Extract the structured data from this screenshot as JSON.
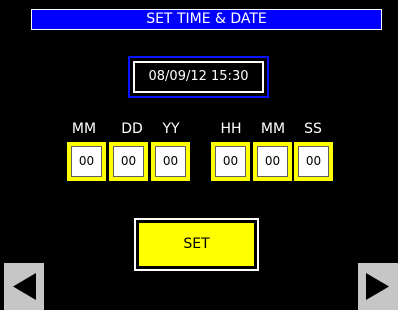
{
  "screen": {
    "title": "SET TIME & DATE",
    "current_datetime": "08/09/12  15:30",
    "fields": [
      {
        "label": "MM",
        "value": "00"
      },
      {
        "label": "DD",
        "value": "00"
      },
      {
        "label": "YY",
        "value": "00"
      },
      {
        "label": "HH",
        "value": "00"
      },
      {
        "label": "MM",
        "value": "00"
      },
      {
        "label": "SS",
        "value": "00"
      }
    ],
    "set_label": "SET"
  },
  "colors": {
    "background": "#000000",
    "title_bar": "#0000ff",
    "field_accent": "#ffff00",
    "nav_button": "#c6c6c6"
  },
  "icons": {
    "previous": "arrow-left-icon",
    "next": "arrow-right-icon"
  }
}
